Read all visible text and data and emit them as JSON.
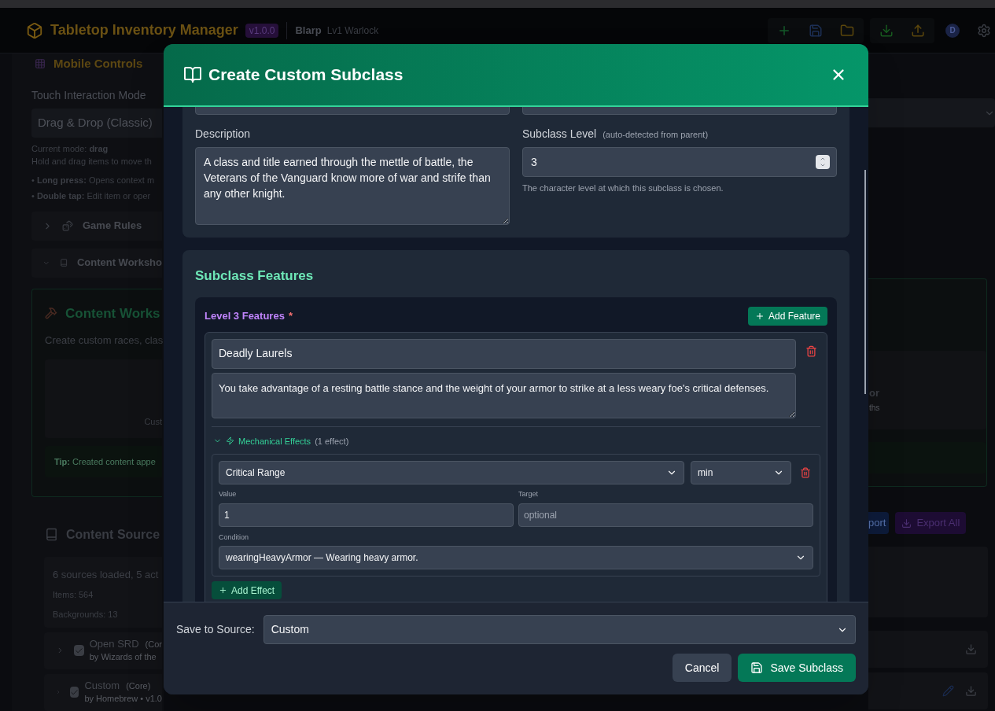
{
  "header": {
    "app_title": "Tabletop Inventory Manager",
    "version": "v1.0.0",
    "character_name": "Blarp",
    "character_class": "Lv1 Warlock",
    "avatar_initial": "D"
  },
  "left_panel": {
    "section_title": "Mobile Controls",
    "mode_label": "Touch Interaction Mode",
    "mode_value": "Drag & Drop (Classic)",
    "current_mode": "Current mode: **drag**",
    "hint": "Hold and drag items to move th",
    "tips": [
      "• **Long press:** Opens context m",
      "• **Double tap:** Edit item or oper"
    ],
    "collapsibles": [
      {
        "label": "Game Rules",
        "expanded": false
      },
      {
        "label": "Content Worksho",
        "expanded": true
      }
    ],
    "workshop": {
      "title": "Content Works",
      "subtitle": "Create custom races, clas",
      "card_text": "Cust",
      "tip": "**Tip:** Created content appe"
    },
    "sources": {
      "title": "Content Source",
      "summary": "6 sources loaded, 5 act",
      "stats": [
        "Items: 564",
        "Backgrounds: 13"
      ],
      "items": [
        {
          "name": "Open SRD",
          "tag": "(Cor",
          "byline": "by Wizards of the",
          "checked": true
        },
        {
          "name": "Custom",
          "tag": "(Core)",
          "byline": "by Homebrew • v1.0",
          "checked": true
        }
      ]
    }
  },
  "right_panel": {
    "card_title": "or",
    "card_subtitle": "ths",
    "import_button": "port",
    "export_button": "Export All"
  },
  "dialog": {
    "title": "Create Custom Subclass",
    "description": {
      "label": "Description",
      "value": "A class and title earned through the mettle of battle, the Veterans of the Vanguard know more of war and strife than any other knight."
    },
    "subclass_level": {
      "label": "Subclass Level",
      "note": "(auto-detected from parent)",
      "value": "3",
      "help": "The character level at which this subclass is chosen."
    },
    "features_title": "Subclass Features",
    "level_group": {
      "title": "Level 3 Features",
      "required_mark": "*",
      "add_button": "Add Feature",
      "features": [
        {
          "name": "Deadly Laurels",
          "description": "You take advantage of a resting battle stance and the weight of your armor to strike at a less weary foe's critical defenses.",
          "effects_title": "Mechanical Effects",
          "effects_count": "(1 effect)",
          "effects_expanded": true,
          "effects": [
            {
              "type": "Critical Range",
              "mode": "min",
              "value_label": "Value",
              "value": "1",
              "target_label": "Target",
              "target_placeholder": "optional",
              "condition_label": "Condition",
              "condition": "wearingHeavyArmor — Wearing heavy armor."
            }
          ],
          "add_effect_button": "Add Effect"
        }
      ]
    },
    "save_to_label": "Save to Source:",
    "save_to_value": "Custom",
    "cancel_button": "Cancel",
    "save_button": "Save Subclass"
  }
}
